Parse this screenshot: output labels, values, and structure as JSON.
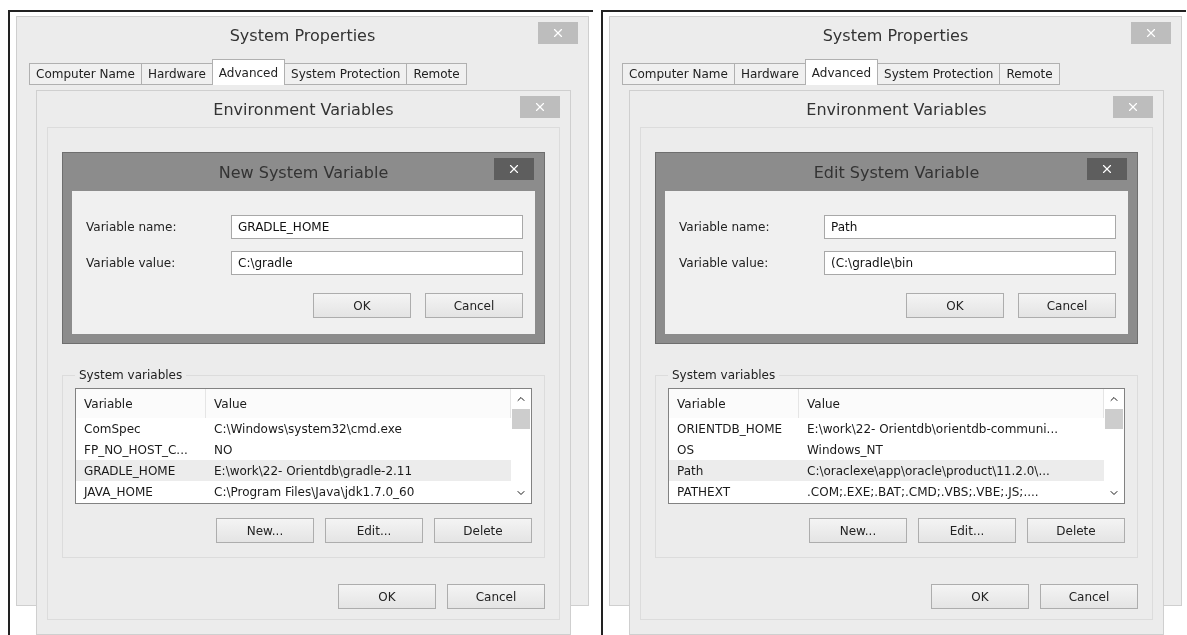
{
  "panels": [
    {
      "system_properties": {
        "title": "System Properties",
        "tabs": [
          {
            "label": "Computer Name",
            "selected": false
          },
          {
            "label": "Hardware",
            "selected": false
          },
          {
            "label": "Advanced",
            "selected": true
          },
          {
            "label": "System Protection",
            "selected": false
          },
          {
            "label": "Remote",
            "selected": false
          }
        ]
      },
      "environment_variables": {
        "title": "Environment Variables",
        "system_variables": {
          "label": "System variables",
          "columns": [
            "Variable",
            "Value"
          ],
          "rows": [
            {
              "variable": "ComSpec",
              "value": "C:\\Windows\\system32\\cmd.exe",
              "selected": false
            },
            {
              "variable": "FP_NO_HOST_C...",
              "value": "NO",
              "selected": false
            },
            {
              "variable": "GRADLE_HOME",
              "value": "E:\\work\\22- Orientdb\\gradle-2.11",
              "selected": true
            },
            {
              "variable": "JAVA_HOME",
              "value": "C:\\Program Files\\Java\\jdk1.7.0_60",
              "selected": false
            }
          ]
        },
        "list_buttons": [
          "New...",
          "Edit...",
          "Delete"
        ],
        "buttons": [
          "OK",
          "Cancel"
        ]
      },
      "dialog": {
        "title": "New System Variable",
        "fields": [
          {
            "label": "Variable name:",
            "value": "GRADLE_HOME"
          },
          {
            "label": "Variable value:",
            "value": "C:\\gradle"
          }
        ],
        "buttons": [
          "OK",
          "Cancel"
        ]
      }
    },
    {
      "system_properties": {
        "title": "System Properties",
        "tabs": [
          {
            "label": "Computer Name",
            "selected": false
          },
          {
            "label": "Hardware",
            "selected": false
          },
          {
            "label": "Advanced",
            "selected": true
          },
          {
            "label": "System Protection",
            "selected": false
          },
          {
            "label": "Remote",
            "selected": false
          }
        ]
      },
      "environment_variables": {
        "title": "Environment Variables",
        "system_variables": {
          "label": "System variables",
          "columns": [
            "Variable",
            "Value"
          ],
          "rows": [
            {
              "variable": "ORIENTDB_HOME",
              "value": "E:\\work\\22- Orientdb\\orientdb-communi...",
              "selected": false
            },
            {
              "variable": "OS",
              "value": "Windows_NT",
              "selected": false
            },
            {
              "variable": "Path",
              "value": "C:\\oraclexe\\app\\oracle\\product\\11.2.0\\...",
              "selected": true
            },
            {
              "variable": "PATHEXT",
              "value": ".COM;.EXE;.BAT;.CMD;.VBS;.VBE;.JS;....",
              "selected": false
            }
          ]
        },
        "list_buttons": [
          "New...",
          "Edit...",
          "Delete"
        ],
        "buttons": [
          "OK",
          "Cancel"
        ]
      },
      "dialog": {
        "title": "Edit System Variable",
        "fields": [
          {
            "label": "Variable name:",
            "value": "Path"
          },
          {
            "label": "Variable value:",
            "value": "(C:\\gradle\\bin"
          }
        ],
        "buttons": [
          "OK",
          "Cancel"
        ]
      }
    }
  ]
}
